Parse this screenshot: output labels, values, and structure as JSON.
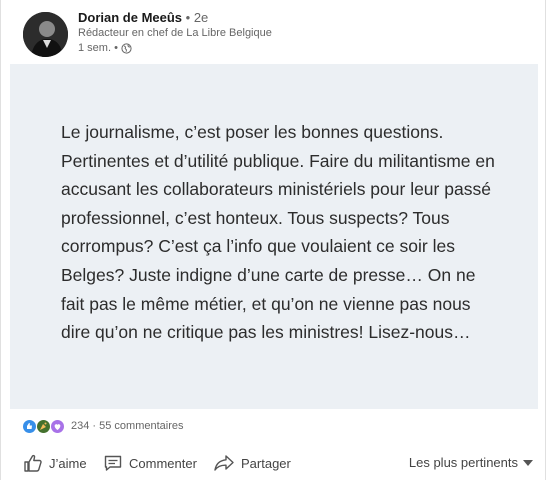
{
  "post": {
    "author": {
      "name": "Dorian de Meeûs",
      "degree": "• 2e",
      "headline": "Rédacteur en chef de La Libre Belgique",
      "time": "1 sem. •"
    },
    "quote": "Le journalisme, c’est poser les bonnes questions. Pertinentes et d’utilité publique. Faire du militantisme en accusant les collaborateurs ministériels pour leur passé professionnel, c’est honteux. Tous suspects? Tous corrompus? C’est ça l’info que voulaient ce soir les Belges? Juste indigne d’une carte de presse… On ne fait pas le même métier, et qu’on ne vienne pas nous dire qu’on ne critique pas les ministres! Lisez-nous…",
    "reactions": {
      "icons": [
        "like-icon",
        "celebrate-icon",
        "support-icon"
      ],
      "summary": "234 · 55 commentaires"
    }
  },
  "actions": {
    "like_label": "J’aime",
    "comment_label": "Commenter",
    "share_label": "Partager",
    "sort_label": "Les plus pertinents"
  },
  "colors": {
    "quote_background": "#ecf0f4",
    "like": "#378fe9",
    "celebrate": "#44712e",
    "support": "#a872e8"
  }
}
